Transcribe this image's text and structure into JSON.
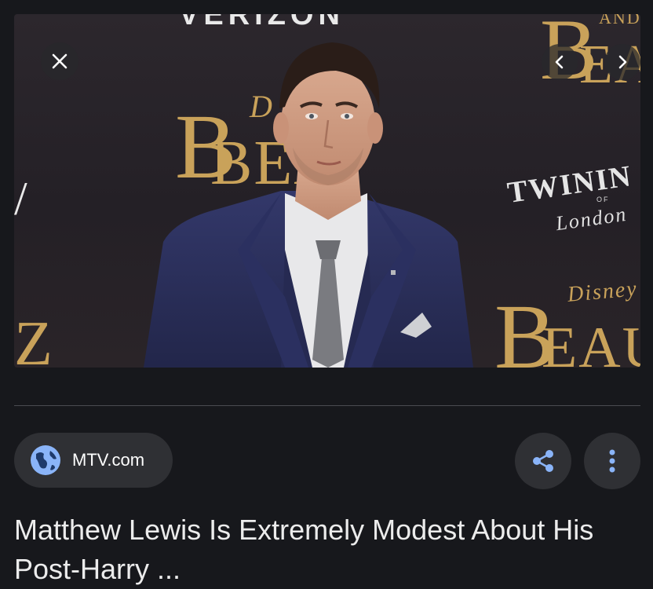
{
  "image": {
    "backdrop": {
      "top_text": "VERIZON",
      "beauty_b": "B",
      "bea": "BEA",
      "d": "D",
      "and": "AND",
      "b_right": "B",
      "bea_right": "EA",
      "twinings": "TWININ",
      "of": "OF",
      "london": "London",
      "disney": "Disney",
      "b_lower": "B",
      "beau": "EAU"
    },
    "subject": "Man in navy three-piece suit and grey knit tie",
    "colors": {
      "suit": "#2a2f5c",
      "shirt": "#e8e8ea",
      "tie": "#7a7b80",
      "gold": "#c9a25a"
    }
  },
  "controls": {
    "close_icon": "close-icon",
    "prev_icon": "chevron-left-icon",
    "next_icon": "chevron-right-icon",
    "share_icon": "share-icon",
    "more_icon": "more-vertical-icon",
    "globe_icon": "globe-icon"
  },
  "source": {
    "name": "MTV.com"
  },
  "result": {
    "title": "Matthew Lewis Is Extremely Modest About His Post-Harry ..."
  },
  "theme": {
    "background": "#17181c",
    "chip": "#2f3034",
    "accent": "#8ab4f8"
  }
}
